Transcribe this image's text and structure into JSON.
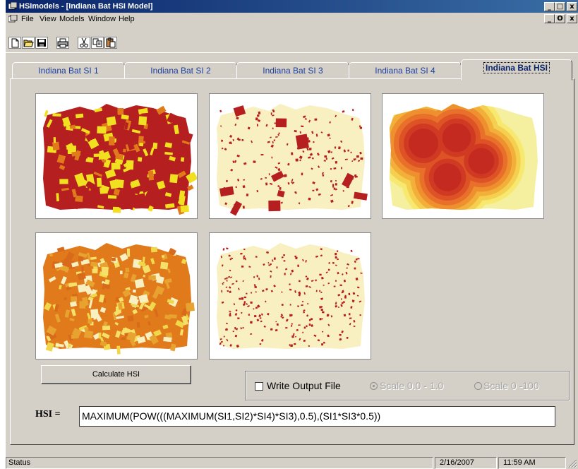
{
  "window": {
    "title": "HSImodels - [Indiana Bat HSI Model]",
    "controls": [
      "_",
      "□",
      "x"
    ],
    "mdi_controls": [
      "_",
      "ʘ",
      "x"
    ]
  },
  "menu": [
    "File",
    "View",
    "Models",
    "Window",
    "Help"
  ],
  "toolbar": [
    "new-document",
    "open-folder",
    "save",
    "print",
    "cut",
    "copy",
    "paste"
  ],
  "tabs": [
    "Indiana Bat SI 1",
    "Indiana Bat SI 2",
    "Indiana Bat SI 3",
    "Indiana Bat SI 4",
    "Indiana Bat HSI"
  ],
  "active_tab": 4,
  "maps": [
    "SI 1 map",
    "SI 2 map",
    "SI 3 map",
    "SI 4 map",
    "HSI map"
  ],
  "colors": {
    "dark_red": "#b51f1f",
    "orange": "#e07a1a",
    "yellow": "#f0e020",
    "cream": "#f8f0c0"
  },
  "calculate_button": "Calculate HSI",
  "options": {
    "write_output_label": "Write Output File",
    "write_output_checked": false,
    "scale_a": "Scale 0.0 - 1.0",
    "scale_b": "Scale 0 -100",
    "scale_selected": "Scale 0.0 - 1.0"
  },
  "formula": {
    "label": "HSI =",
    "value": "MAXIMUM(POW(((MAXIMUM(SI1,SI2)*SI4)*SI3),0.5),(SI1*SI3*0.5))"
  },
  "status": {
    "label": "Status",
    "date": "2/16/2007",
    "time": "11:59 AM"
  }
}
